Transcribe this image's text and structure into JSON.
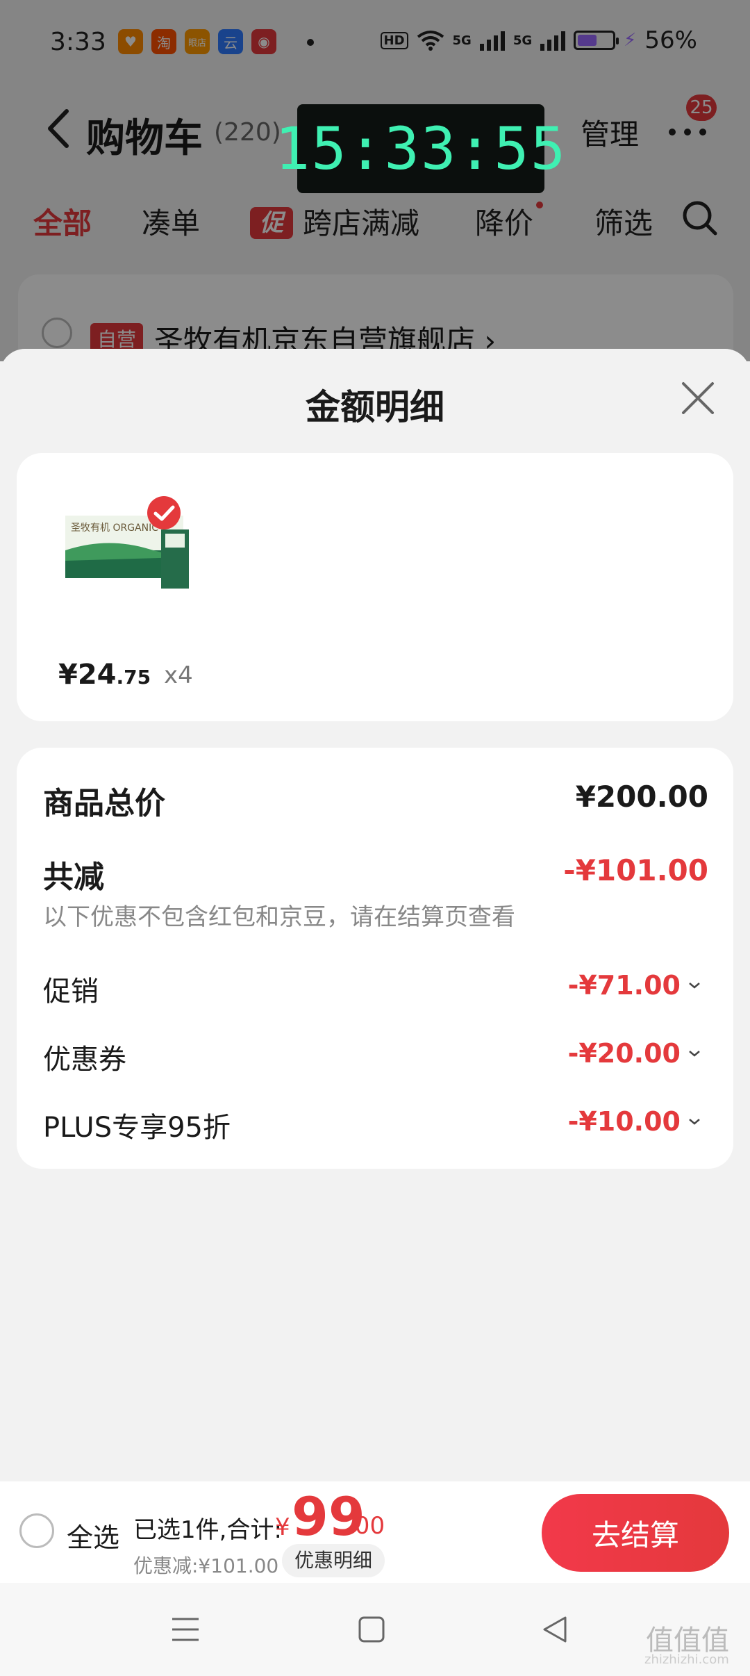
{
  "status_bar": {
    "time": "3:33",
    "apps": [
      {
        "name": "health-app",
        "glyph": "♥",
        "color": "#ff8a00"
      },
      {
        "name": "taobao-app",
        "glyph": "淘",
        "color": "#ff5000"
      },
      {
        "name": "store-app",
        "glyph": "眼店",
        "color": "#ff9a00"
      },
      {
        "name": "cloud-app",
        "glyph": "云",
        "color": "#2f7bff"
      },
      {
        "name": "netease-music-app",
        "glyph": "◉",
        "color": "#e4393c"
      }
    ],
    "hd_label": "HD",
    "net1": "5G",
    "net2": "5G",
    "battery_percent": "56%",
    "battery_level": 0.56
  },
  "nav": {
    "title": "购物车",
    "count": "(220)",
    "manage": "管理",
    "badge": "25"
  },
  "clock_overlay": "15:33:55",
  "tabs": {
    "all": "全部",
    "bundle": "凑单",
    "promo_tag": "促",
    "cross_store": "跨店满减",
    "price_drop": "降价",
    "filter": "筛选"
  },
  "store": {
    "self_tag": "自营",
    "name": "圣牧有机京东自营旗舰店 ›"
  },
  "sheet": {
    "title": "金额明细",
    "product": {
      "image_text": "圣牧有机 ORGANIC",
      "price_cur": "¥",
      "price_int": "24",
      "price_dec": ".75",
      "qty": "x4"
    },
    "summary": {
      "total_label": "商品总价",
      "total_value": "¥200.00",
      "reduce_label": "共减",
      "reduce_value": "-¥101.00",
      "note": "以下优惠不包含红包和京豆，请在结算页查看",
      "items": [
        {
          "label": "促销",
          "value": "-¥71.00"
        },
        {
          "label": "优惠券",
          "value": "-¥20.00"
        },
        {
          "label": "PLUS专享95折",
          "value": "-¥10.00"
        }
      ]
    }
  },
  "checkout": {
    "select_all": "全选",
    "selected_info": "已选1件,合计:",
    "total_cur": "¥",
    "total_int": "99",
    "total_dec": ".00",
    "discount_text": "优惠减:¥101.00",
    "detail_chip": "优惠明细",
    "button": "去结算"
  },
  "watermark": {
    "main": "值值值",
    "sub": "zhizhizhi.com"
  },
  "colors": {
    "accent": "#e4393c",
    "clock": "#3ff0b2"
  }
}
